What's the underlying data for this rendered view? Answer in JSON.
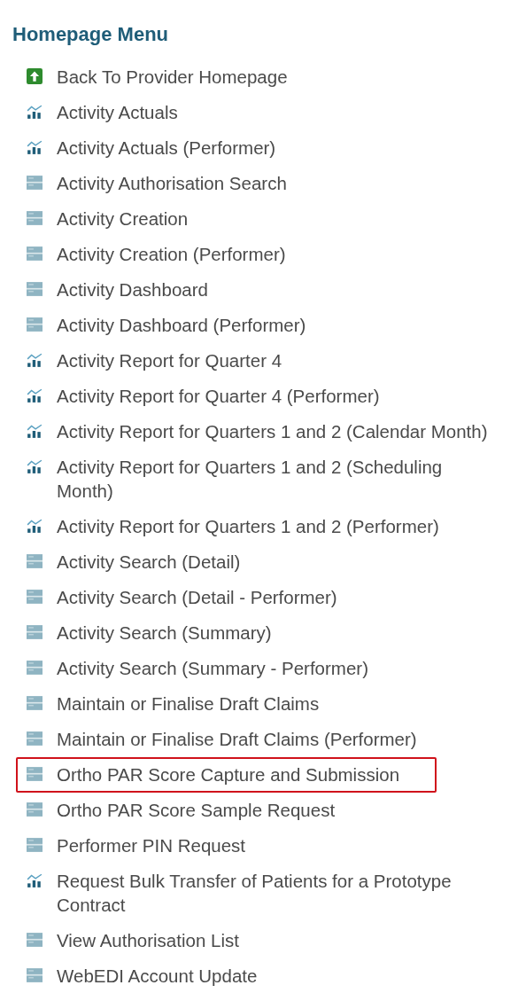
{
  "menu": {
    "title": "Homepage Menu",
    "items": [
      {
        "label": "Back To Provider Homepage",
        "kind": "home",
        "highlighted": false
      },
      {
        "label": "Activity Actuals",
        "kind": "chart",
        "highlighted": false
      },
      {
        "label": "Activity Actuals (Performer)",
        "kind": "chart",
        "highlighted": false
      },
      {
        "label": "Activity Authorisation Search",
        "kind": "form",
        "highlighted": false
      },
      {
        "label": "Activity Creation",
        "kind": "form",
        "highlighted": false
      },
      {
        "label": "Activity Creation (Performer)",
        "kind": "form",
        "highlighted": false
      },
      {
        "label": "Activity Dashboard",
        "kind": "form",
        "highlighted": false
      },
      {
        "label": "Activity Dashboard (Performer)",
        "kind": "form",
        "highlighted": false
      },
      {
        "label": "Activity Report for Quarter 4",
        "kind": "chart",
        "highlighted": false
      },
      {
        "label": "Activity Report for Quarter 4 (Performer)",
        "kind": "chart",
        "highlighted": false
      },
      {
        "label": "Activity Report for Quarters 1 and 2 (Calendar Month)",
        "kind": "chart",
        "highlighted": false
      },
      {
        "label": "Activity Report for Quarters 1 and 2 (Scheduling Month)",
        "kind": "chart",
        "highlighted": false
      },
      {
        "label": "Activity Report for Quarters 1 and 2 (Performer)",
        "kind": "chart",
        "highlighted": false
      },
      {
        "label": "Activity Search (Detail)",
        "kind": "form",
        "highlighted": false
      },
      {
        "label": "Activity Search (Detail - Performer)",
        "kind": "form",
        "highlighted": false
      },
      {
        "label": "Activity Search (Summary)",
        "kind": "form",
        "highlighted": false
      },
      {
        "label": "Activity Search (Summary - Performer)",
        "kind": "form",
        "highlighted": false
      },
      {
        "label": "Maintain or Finalise Draft Claims",
        "kind": "form",
        "highlighted": false
      },
      {
        "label": "Maintain or Finalise Draft Claims (Performer)",
        "kind": "form",
        "highlighted": false
      },
      {
        "label": "Ortho PAR Score Capture and Submission",
        "kind": "form",
        "highlighted": true
      },
      {
        "label": "Ortho PAR Score Sample Request",
        "kind": "form",
        "highlighted": false
      },
      {
        "label": "Performer PIN Request",
        "kind": "form",
        "highlighted": false
      },
      {
        "label": "Request Bulk Transfer of Patients for a Prototype Contract",
        "kind": "chart",
        "highlighted": false
      },
      {
        "label": "View Authorisation List",
        "kind": "form",
        "highlighted": false
      },
      {
        "label": "WebEDI Account Update",
        "kind": "form",
        "highlighted": false
      }
    ]
  }
}
